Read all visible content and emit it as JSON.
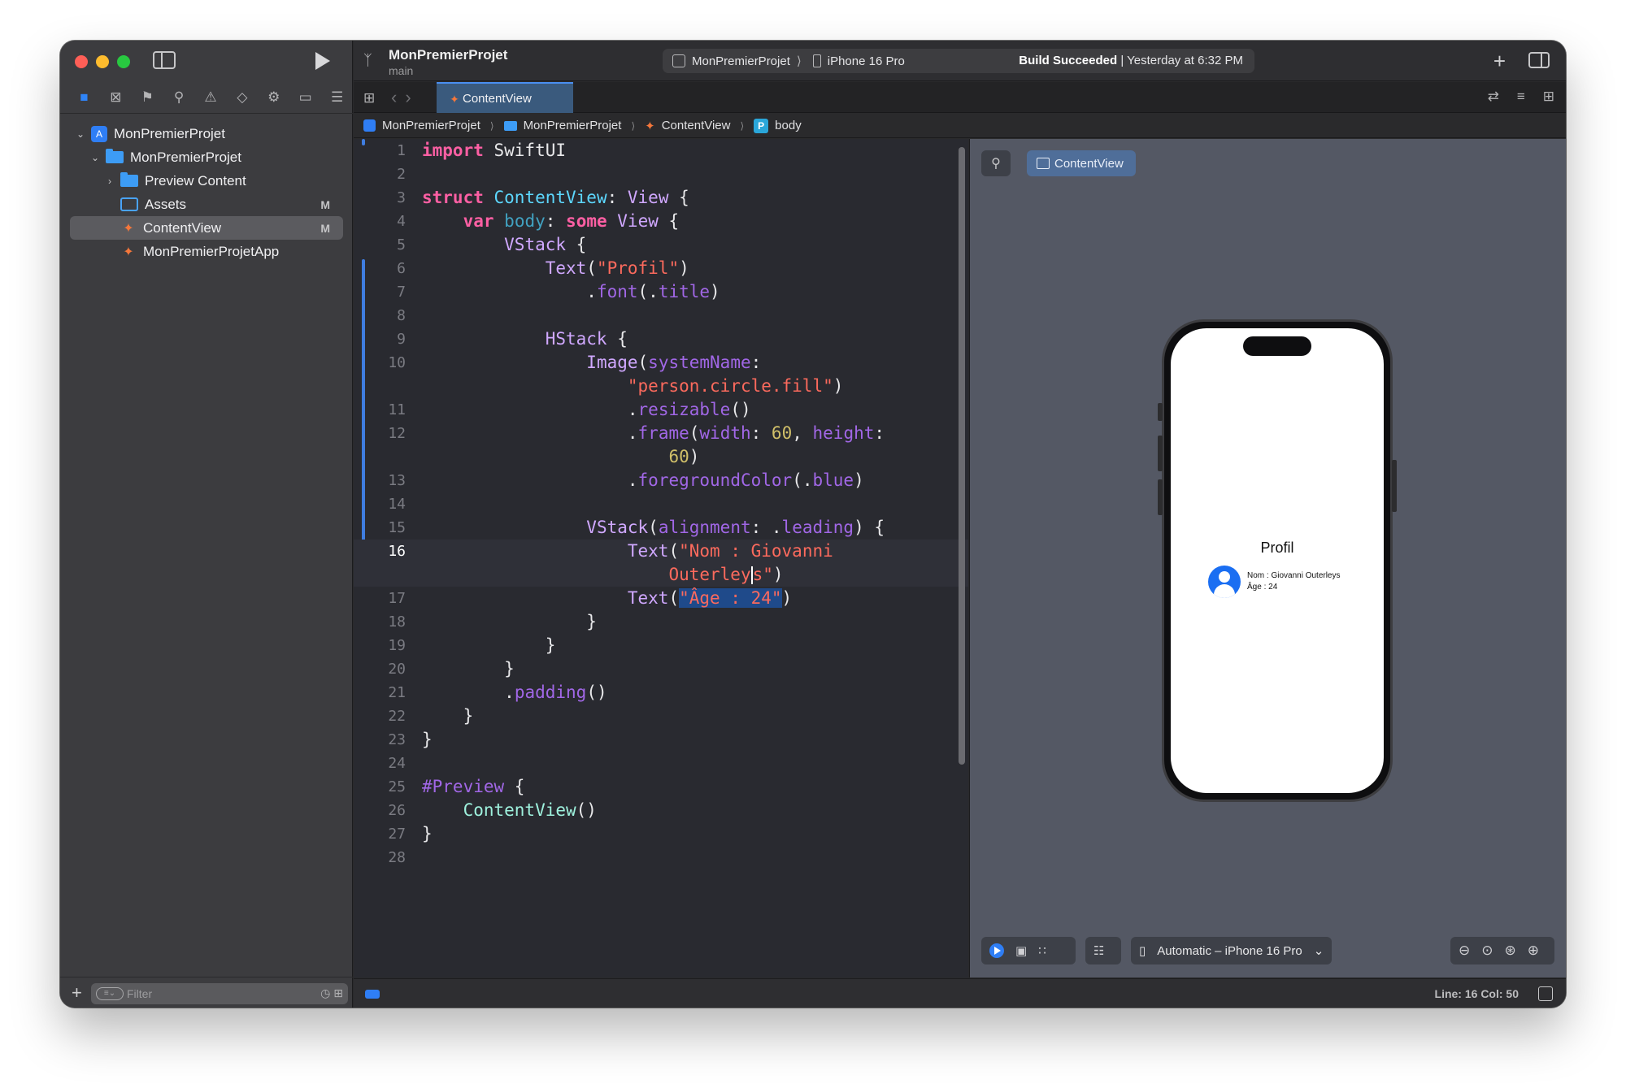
{
  "toolbar": {
    "project_name": "MonPremierProjet",
    "branch": "main",
    "scheme": "MonPremierProjet",
    "device": "iPhone 16 Pro",
    "build_status_bold": "Build Succeeded",
    "build_status_time": "| Yesterday at 6:32 PM"
  },
  "navigator": {
    "tree": [
      {
        "label": "MonPremierProjet",
        "kind": "project",
        "level": 0,
        "expanded": true
      },
      {
        "label": "MonPremierProjet",
        "kind": "folder",
        "level": 1,
        "expanded": true
      },
      {
        "label": "Preview Content",
        "kind": "folder",
        "level": 2,
        "expanded": false
      },
      {
        "label": "Assets",
        "kind": "assets",
        "level": 2,
        "badge": "M"
      },
      {
        "label": "ContentView",
        "kind": "swift",
        "level": 2,
        "badge": "M",
        "selected": true
      },
      {
        "label": "MonPremierProjetApp",
        "kind": "swift",
        "level": 2
      }
    ],
    "filter_placeholder": "Filter"
  },
  "tabs": {
    "active": "ContentView"
  },
  "jump_bar": {
    "items": [
      "MonPremierProjet",
      "MonPremierProjet",
      "ContentView",
      "body"
    ],
    "symbol_badge": "P"
  },
  "editor": {
    "language": "Swift",
    "current_line": 16,
    "lines": [
      {
        "n": "1"
      },
      {
        "n": "2"
      },
      {
        "n": "3"
      },
      {
        "n": "4"
      },
      {
        "n": "5"
      },
      {
        "n": "6"
      },
      {
        "n": "7"
      },
      {
        "n": "8"
      },
      {
        "n": "9"
      },
      {
        "n": "10"
      },
      {
        "n": "11"
      },
      {
        "n": "12"
      },
      {
        "n": "13"
      },
      {
        "n": "14"
      },
      {
        "n": "15"
      },
      {
        "n": "16"
      },
      {
        "n": "17"
      },
      {
        "n": "18"
      },
      {
        "n": "19"
      },
      {
        "n": "20"
      },
      {
        "n": "21"
      },
      {
        "n": "22"
      },
      {
        "n": "23"
      },
      {
        "n": "24"
      },
      {
        "n": "25"
      },
      {
        "n": "26"
      },
      {
        "n": "27"
      },
      {
        "n": "28"
      }
    ],
    "tokens": {
      "l1": [
        "import",
        " SwiftUI"
      ],
      "l3": [
        "struct",
        " ",
        "ContentView",
        ": ",
        "View",
        " {"
      ],
      "l4": [
        "var",
        " ",
        "body",
        ": ",
        "some",
        " ",
        "View",
        " {"
      ],
      "l5": [
        "VStack",
        " {"
      ],
      "l6": [
        "Text",
        "(",
        "\"Profil\"",
        ")"
      ],
      "l7": [
        ".",
        "font",
        "(.",
        "title",
        ")"
      ],
      "l9": [
        "HStack",
        " {"
      ],
      "l10": [
        "Image",
        "(",
        "systemName",
        ":"
      ],
      "l10b": [
        "\"person.circle.fill\"",
        ")"
      ],
      "l11": [
        ".",
        "resizable",
        "()"
      ],
      "l12": [
        ".",
        "frame",
        "(",
        "width",
        ": ",
        "60",
        ", ",
        "height",
        ":"
      ],
      "l12b": [
        "60",
        ")"
      ],
      "l13": [
        ".",
        "foregroundColor",
        "(.",
        "blue",
        ")"
      ],
      "l15": [
        "VStack",
        "(",
        "alignment",
        ": .",
        "leading",
        ") {"
      ],
      "l16": [
        "Text",
        "(",
        "\"Nom : Giovanni"
      ],
      "l16b": [
        "Outerley",
        "s\"",
        ")"
      ],
      "l17": [
        "Text",
        "(",
        "\"Âge : 24\"",
        ")"
      ],
      "l18": [
        "}"
      ],
      "l19": [
        "}"
      ],
      "l20": [
        "}"
      ],
      "l21": [
        ".",
        "padding",
        "()"
      ],
      "l22": [
        "}"
      ],
      "l23": [
        "}"
      ],
      "l25": [
        "#Preview",
        " {"
      ],
      "l26": [
        "ContentView",
        "()"
      ],
      "l27": [
        "}"
      ]
    }
  },
  "preview": {
    "view_button": "ContentView",
    "screen_title": "Profil",
    "name_line": "Nom : Giovanni Outerleys",
    "age_line": "Âge : 24",
    "device_picker": "Automatic – iPhone 16 Pro"
  },
  "status": {
    "position": "Line: 16  Col: 50"
  },
  "colors": {
    "accent": "#2f7ef5",
    "keyword": "#fc5fa3",
    "type": "#5dd8ff",
    "function": "#a167e6",
    "string": "#fc6a5d",
    "number": "#d0bf69"
  }
}
